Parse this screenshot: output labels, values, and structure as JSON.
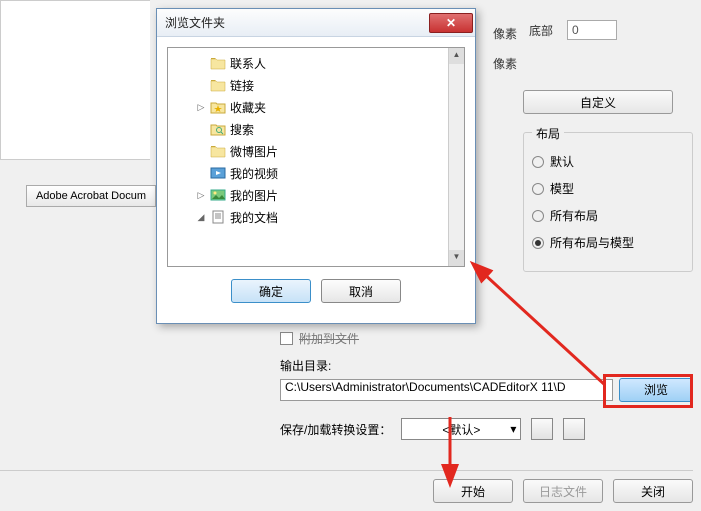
{
  "background": {
    "filetype_text": "Adobe Acrobat Docum",
    "px_label1": "像素",
    "px_label2": "像素",
    "bottom_label": "底部",
    "bottom_value": "0",
    "custom_btn": "自定义"
  },
  "layout_group": {
    "title": "布局",
    "options": [
      "默认",
      "模型",
      "所有布局",
      "所有布局与模型"
    ],
    "selected_index": 3
  },
  "output": {
    "attach_checkbox_label": "附加到文件",
    "dir_label": "输出目录:",
    "dir_value": "C:\\Users\\Administrator\\Documents\\CADEditorX 11\\D",
    "browse_btn": "浏览"
  },
  "save_settings": {
    "label": "保存/加载转换设置：",
    "preset_value": "<默认>"
  },
  "buttons": {
    "start": "开始",
    "log": "日志文件",
    "close": "关闭"
  },
  "dialog": {
    "title": "浏览文件夹",
    "ok": "确定",
    "cancel": "取消",
    "tree": [
      {
        "label": "联系人",
        "level": 2,
        "expander": "",
        "icon": "contacts"
      },
      {
        "label": "链接",
        "level": 2,
        "expander": "",
        "icon": "links"
      },
      {
        "label": "收藏夹",
        "level": 2,
        "expander": "▷",
        "icon": "fav"
      },
      {
        "label": "搜索",
        "level": 2,
        "expander": "",
        "icon": "search"
      },
      {
        "label": "微博图片",
        "level": 2,
        "expander": "",
        "icon": "folder"
      },
      {
        "label": "我的视频",
        "level": 2,
        "expander": "",
        "icon": "video"
      },
      {
        "label": "我的图片",
        "level": 2,
        "expander": "▷",
        "icon": "pics"
      },
      {
        "label": "我的文档",
        "level": 2,
        "expander": "◢",
        "icon": "docs"
      }
    ]
  }
}
